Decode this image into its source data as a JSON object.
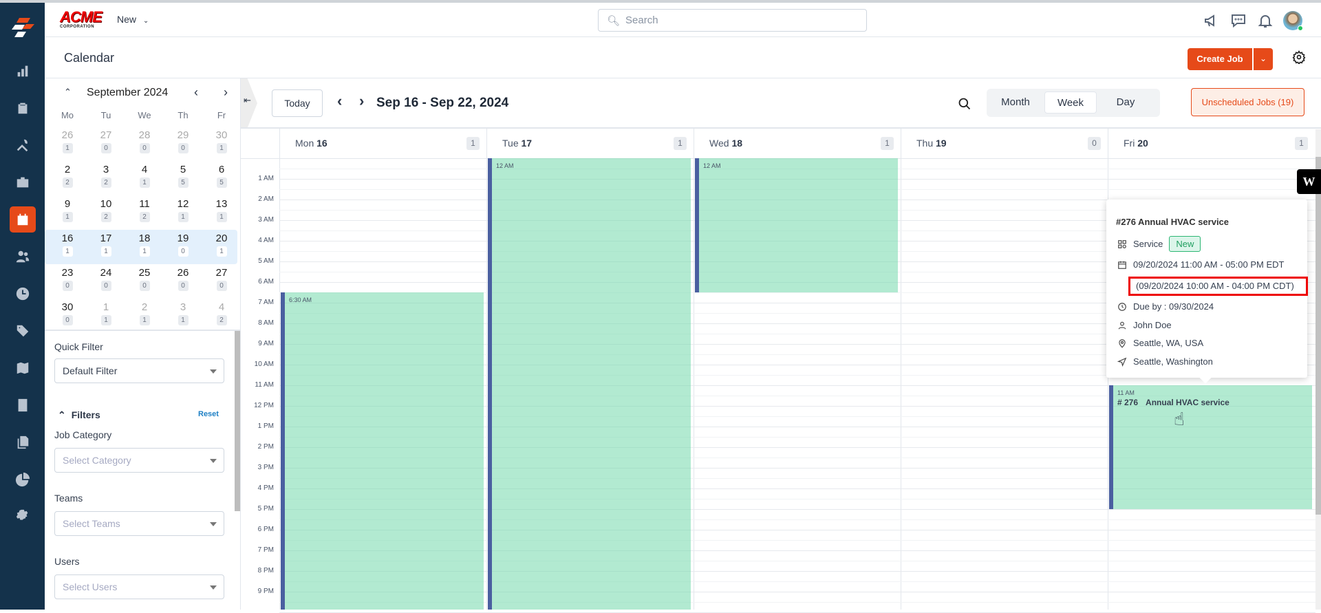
{
  "app": {
    "logo_text": "ACME CORPORATION",
    "new_label": "New",
    "search_placeholder": "Search"
  },
  "colors": {
    "accent": "#e64a19",
    "sidebar": "#14324b",
    "event": "#b2e9d4",
    "event_border": "#4a5fa0"
  },
  "sidebar": {
    "items": [
      {
        "icon": "chart-icon"
      },
      {
        "icon": "clipboard-icon"
      },
      {
        "icon": "tools-icon"
      },
      {
        "icon": "briefcase-icon"
      },
      {
        "icon": "calendar-icon",
        "active": true
      },
      {
        "icon": "users-icon"
      },
      {
        "icon": "clock-icon"
      },
      {
        "icon": "tag-icon"
      },
      {
        "icon": "map-icon"
      },
      {
        "icon": "invoice-icon"
      },
      {
        "icon": "files-icon"
      },
      {
        "icon": "pie-chart-icon"
      },
      {
        "icon": "settings-icon"
      }
    ]
  },
  "page": {
    "title": "Calendar",
    "create_job": "Create Job"
  },
  "mini_calendar": {
    "month_label": "September 2024",
    "dow": [
      "Mo",
      "Tu",
      "We",
      "Th",
      "Fr"
    ],
    "weeks": [
      [
        {
          "d": "26",
          "c": "1",
          "m": true
        },
        {
          "d": "27",
          "c": "0",
          "m": true
        },
        {
          "d": "28",
          "c": "0",
          "m": true
        },
        {
          "d": "29",
          "c": "0",
          "m": true
        },
        {
          "d": "30",
          "c": "1",
          "m": true
        }
      ],
      [
        {
          "d": "2",
          "c": "2"
        },
        {
          "d": "3",
          "c": "2"
        },
        {
          "d": "4",
          "c": "1"
        },
        {
          "d": "5",
          "c": "5"
        },
        {
          "d": "6",
          "c": "5"
        }
      ],
      [
        {
          "d": "9",
          "c": "1"
        },
        {
          "d": "10",
          "c": "2"
        },
        {
          "d": "11",
          "c": "2"
        },
        {
          "d": "12",
          "c": "1"
        },
        {
          "d": "13",
          "c": "1"
        }
      ],
      [
        {
          "d": "16",
          "c": "1"
        },
        {
          "d": "17",
          "c": "1"
        },
        {
          "d": "18",
          "c": "1"
        },
        {
          "d": "19",
          "c": "0"
        },
        {
          "d": "20",
          "c": "1"
        }
      ],
      [
        {
          "d": "23",
          "c": "0"
        },
        {
          "d": "24",
          "c": "0"
        },
        {
          "d": "25",
          "c": "0"
        },
        {
          "d": "26",
          "c": "0"
        },
        {
          "d": "27",
          "c": "0"
        }
      ],
      [
        {
          "d": "30",
          "c": "0"
        },
        {
          "d": "1",
          "c": "1",
          "m": true
        },
        {
          "d": "2",
          "c": "1",
          "m": true
        },
        {
          "d": "3",
          "c": "1",
          "m": true
        },
        {
          "d": "4",
          "c": "2",
          "m": true
        }
      ]
    ],
    "highlight_week": 3
  },
  "filters": {
    "quick_filter_label": "Quick Filter",
    "quick_filter_value": "Default Filter",
    "title": "Filters",
    "reset": "Reset",
    "job_category_label": "Job Category",
    "job_category_placeholder": "Select Category",
    "teams_label": "Teams",
    "teams_placeholder": "Select Teams",
    "users_label": "Users",
    "users_placeholder": "Select Users"
  },
  "toolbar": {
    "today": "Today",
    "range": "Sep 16 - Sep 22, 2024",
    "views": [
      "Month",
      "Week",
      "Day"
    ],
    "active_view": "Week",
    "unscheduled": "Unscheduled Jobs (19)"
  },
  "days": [
    {
      "dow": "Mon",
      "num": "16",
      "count": "1"
    },
    {
      "dow": "Tue",
      "num": "17",
      "count": "1"
    },
    {
      "dow": "Wed",
      "num": "18",
      "count": "1"
    },
    {
      "dow": "Thu",
      "num": "19",
      "count": "0"
    },
    {
      "dow": "Fri",
      "num": "20",
      "count": "1"
    }
  ],
  "hours": [
    "1 AM",
    "2 AM",
    "3 AM",
    "4 AM",
    "5 AM",
    "6 AM",
    "7 AM",
    "8 AM",
    "9 AM",
    "10 AM",
    "11 AM",
    "12 PM",
    "1 PM",
    "2 PM",
    "3 PM",
    "4 PM",
    "5 PM",
    "6 PM",
    "7 PM",
    "8 PM",
    "9 PM"
  ],
  "events": [
    {
      "day": 0,
      "start": 6.5,
      "end": 24,
      "time": "6:30 AM"
    },
    {
      "day": 1,
      "start": 0,
      "end": 24,
      "time": "12 AM"
    },
    {
      "day": 2,
      "start": 0,
      "end": 6.5,
      "time": "12 AM"
    },
    {
      "day": 4,
      "start": 11,
      "end": 17,
      "time": "11 AM",
      "number": "# 276",
      "title": "Annual HVAC service"
    }
  ],
  "popup": {
    "title": "#276 Annual HVAC service",
    "category": "Service",
    "status": "New",
    "time_edt": "09/20/2024 11:00 AM - 05:00 PM EDT",
    "time_cdt": "(09/20/2024 10:00 AM - 04:00 PM CDT)",
    "due": "Due by : 09/30/2024",
    "assignee": "John Doe",
    "location": "Seattle, WA, USA",
    "region": "Seattle, Washington"
  }
}
